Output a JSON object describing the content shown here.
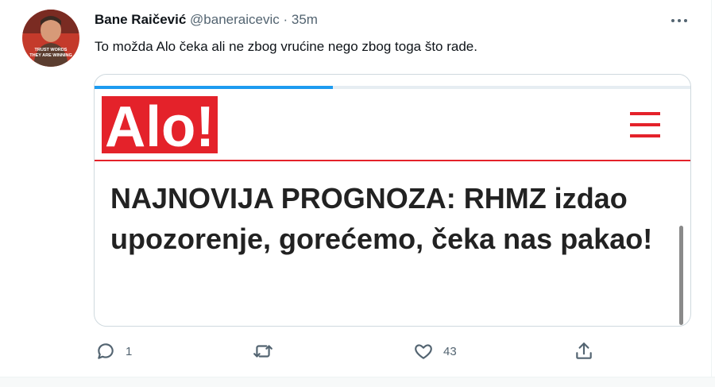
{
  "tweet": {
    "author_name": "Bane Raičević",
    "handle": "@baneraicevic",
    "separator": "·",
    "time": "35m",
    "text": "To možda Alo čeka ali ne zbog vrućine nego zbog toga što rade.",
    "avatar": {
      "line1": "TRUST WORDS",
      "line2": "THEY ARE WINNING"
    }
  },
  "card": {
    "logo_text": "Alo!",
    "headline": "NAJNOVIJA PROGNOZA: RHMZ izdao upozorenje, gorećemo, čeka nas pakao!",
    "colors": {
      "brand_red": "#e4222a",
      "load_bar": "#1d9bf0"
    }
  },
  "actions": {
    "reply_count": "1",
    "retweet_count": "",
    "like_count": "43"
  }
}
